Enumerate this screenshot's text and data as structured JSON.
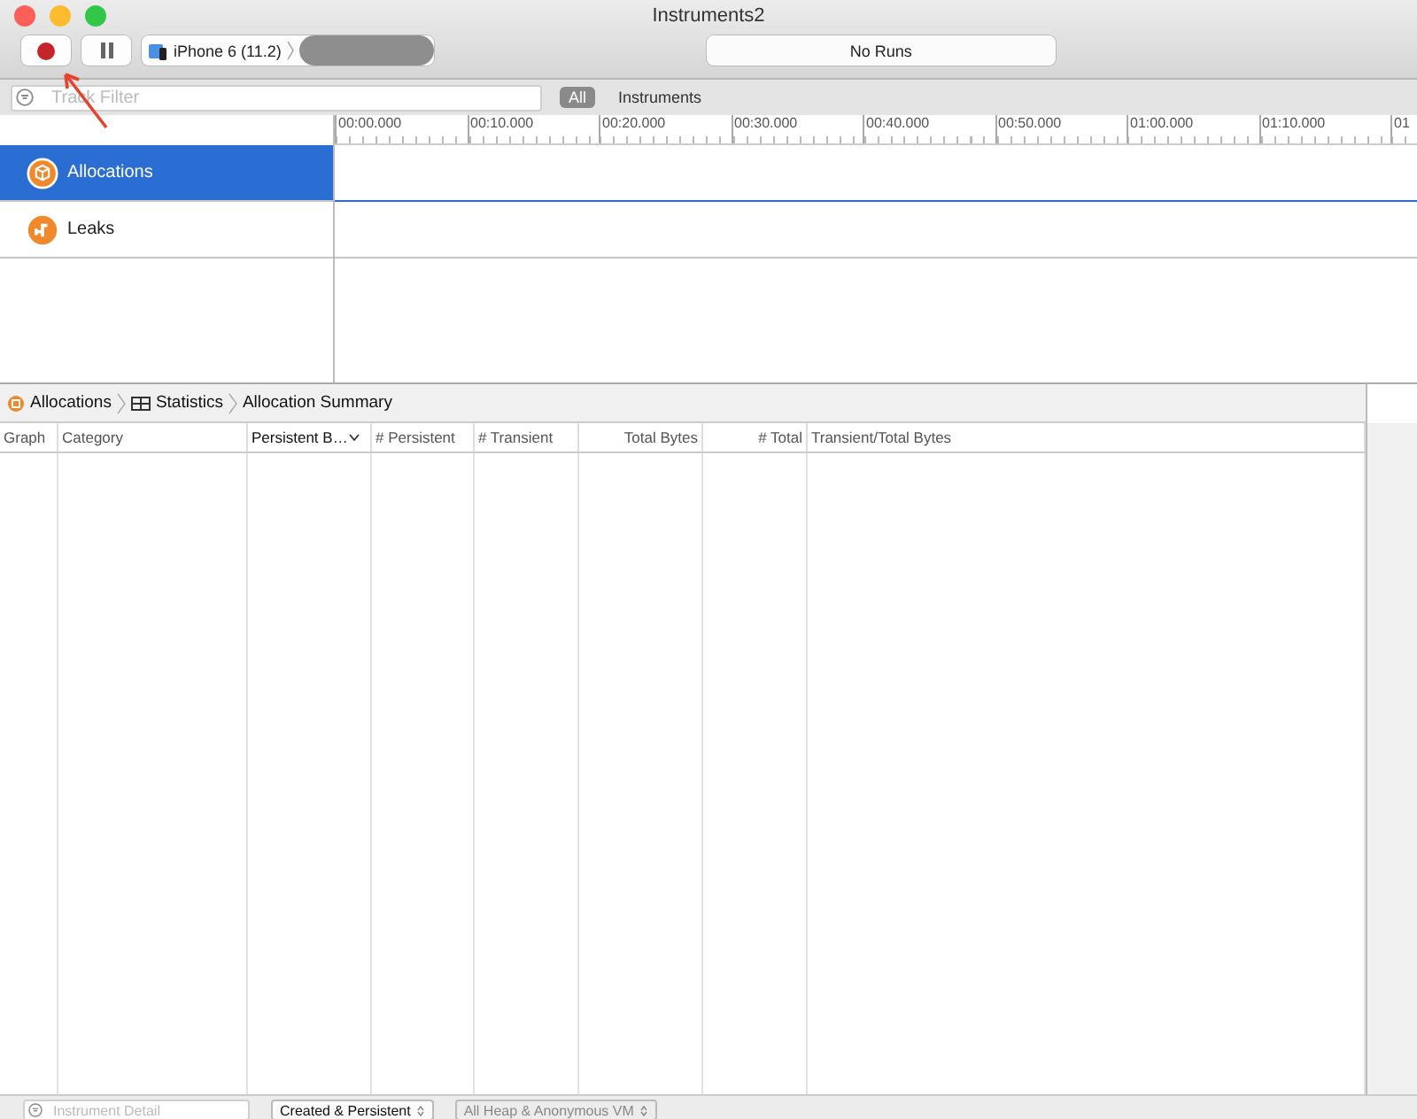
{
  "window": {
    "title": "Instruments2"
  },
  "toolbar": {
    "device": "iPhone 6 (11.2)",
    "runs": "No Runs"
  },
  "filter": {
    "placeholder": "Track Filter",
    "scopes": [
      {
        "label": "All",
        "selected": true
      },
      {
        "label": "Instruments",
        "selected": false
      }
    ]
  },
  "ruler": [
    "00:00.000",
    "00:10.000",
    "00:20.000",
    "00:30.000",
    "00:40.000",
    "00:50.000",
    "01:00.000",
    "01:10.000",
    "01"
  ],
  "tracks": [
    {
      "kind": "allocations",
      "label": "Allocations",
      "selected": true
    },
    {
      "kind": "leaks",
      "label": "Leaks",
      "selected": false
    }
  ],
  "breadcrumb": [
    {
      "kind": "instrument",
      "label": "Allocations"
    },
    {
      "kind": "statistics",
      "label": "Statistics"
    },
    {
      "kind": "plain",
      "label": "Allocation Summary"
    }
  ],
  "columns": [
    {
      "label": "Graph",
      "kind": "text",
      "sorted": false
    },
    {
      "label": "Category",
      "kind": "text",
      "sorted": false
    },
    {
      "label": "Persistent B…",
      "kind": "text",
      "sorted": true
    },
    {
      "label": "# Persistent",
      "kind": "text",
      "sorted": false
    },
    {
      "label": "# Transient",
      "kind": "text",
      "sorted": false
    },
    {
      "label": "Total Bytes",
      "kind": "number",
      "sorted": false
    },
    {
      "label": "# Total",
      "kind": "number",
      "sorted": false
    },
    {
      "label": "Transient/Total Bytes",
      "kind": "text",
      "sorted": false
    }
  ],
  "bottom_bar": {
    "detail_placeholder": "Instrument Detail",
    "popups": [
      "Created & Persistent",
      "All Heap & Anonymous VM"
    ]
  }
}
